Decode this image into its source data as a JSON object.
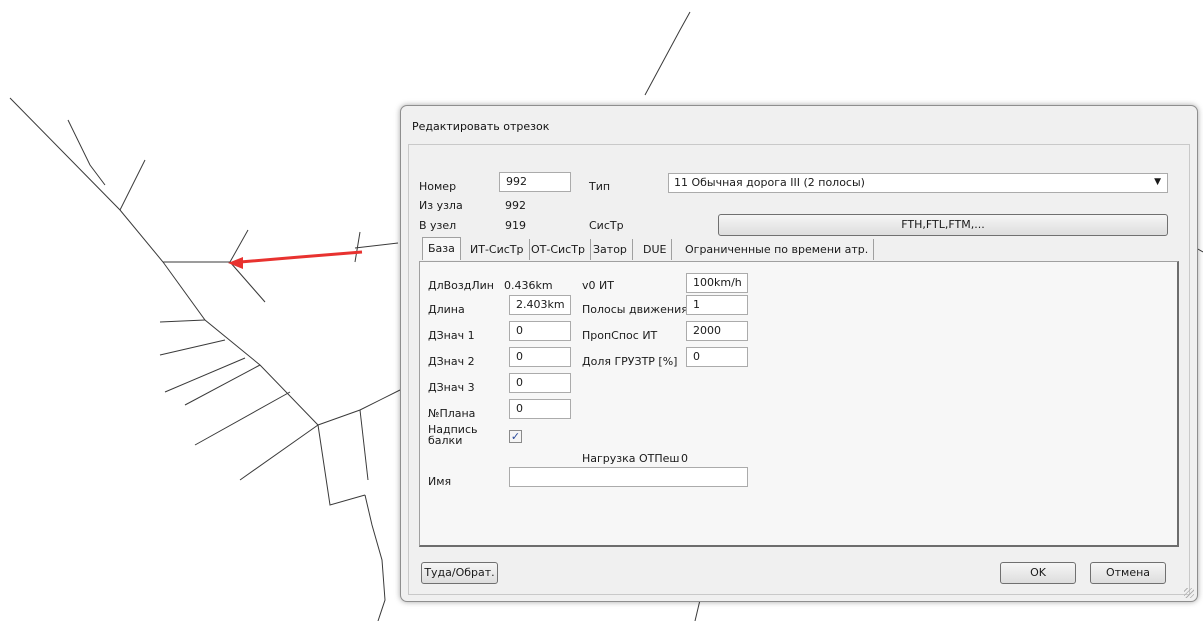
{
  "dialog": {
    "title": "Редактировать отрезок",
    "number_label": "Номер",
    "number_value": "992",
    "from_node_label": "Из узла",
    "from_node_value": "992",
    "to_node_label": "В узел",
    "to_node_value": "919",
    "type_label": "Тип",
    "type_value": "11 Обычная дорога III (2 полосы)",
    "tsys_label": "СисТр",
    "tsys_button": "FTH,FTL,FTM,...",
    "tabs": [
      {
        "label": "База",
        "active": true
      },
      {
        "label": "ИТ-СисТр",
        "active": false
      },
      {
        "label": "ОТ-СисТр",
        "active": false
      },
      {
        "label": "Затор",
        "active": false
      },
      {
        "label": "DUE",
        "active": false
      },
      {
        "label": "Ограниченные по времени атр.",
        "active": false
      }
    ],
    "base": {
      "direct_len_label": "ДлВоздЛин",
      "direct_len_value": "0.436km",
      "length_label": "Длина",
      "length_value": "2.403km",
      "addval1_label": "ДЗнач 1",
      "addval1_value": "0",
      "addval2_label": "ДЗнач 2",
      "addval2_value": "0",
      "addval3_label": "ДЗнач 3",
      "addval3_value": "0",
      "plan_label": "№Плана",
      "plan_value": "0",
      "beam_label_line1": "Надпись",
      "beam_label_line2": "балки",
      "beam_checked": "✓",
      "v0_label": "v0 ИТ",
      "v0_value": "100km/h",
      "lanes_label": "Полосы движения",
      "lanes_value": "1",
      "capacity_label": "ПропСпос ИТ",
      "capacity_value": "2000",
      "hgv_label": "Доля ГРУЗТР [%]",
      "hgv_value": "0",
      "ped_load_label": "Нагрузка ОТПеш",
      "ped_load_value": "0",
      "name_label": "Имя",
      "name_value": ""
    },
    "buttons": {
      "reverse": "Туда/Обрат.",
      "ok": "OK",
      "cancel": "Отмена"
    }
  },
  "colors": {
    "highlight_link": "#e8322f",
    "map_line": "#3a3a3a"
  }
}
